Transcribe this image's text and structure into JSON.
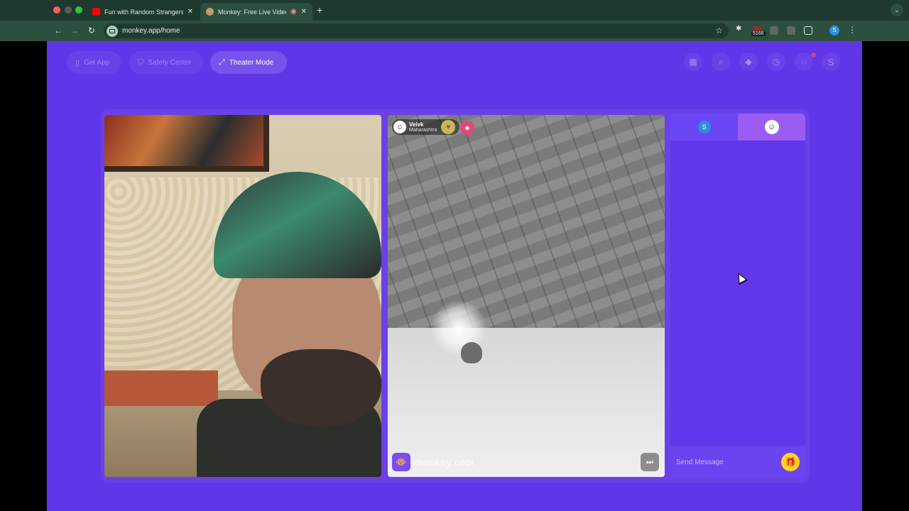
{
  "browser": {
    "tabs": [
      {
        "title": "Fun with Random Strangers -",
        "icon": "youtube-icon",
        "active": false
      },
      {
        "title": "Monkey: Free Live Video C",
        "icon": "monkey-icon",
        "active": true
      }
    ],
    "url": "monkey.app/home",
    "extension_badge": "5166",
    "profile_initial": "S"
  },
  "header": {
    "get_app": "Get App",
    "safety_center": "Safety Center",
    "theater_mode": "Theater Mode",
    "icons": [
      "store-icon",
      "search-icon",
      "gem-icon",
      "history-icon",
      "chat-bubble-icon",
      "profile-icon"
    ],
    "profile_initial": "S"
  },
  "remote": {
    "name": "Veivk",
    "location": "Maharashtra",
    "watermark": "monkey.cool"
  },
  "chat": {
    "me_initial": "S",
    "placeholder": "Send Message"
  },
  "colors": {
    "page_bg": "#6136e8",
    "chrome_bg": "#1e3a2f",
    "accent": "#ffd21f"
  }
}
